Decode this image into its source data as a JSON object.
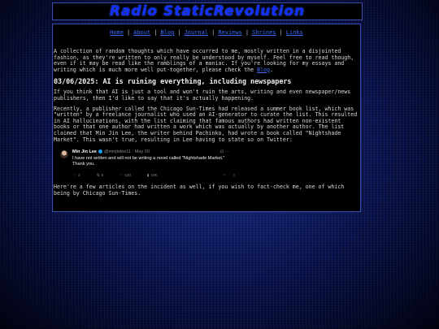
{
  "site": {
    "title": "Radio StaticRevolution"
  },
  "nav": [
    {
      "label": "Home"
    },
    {
      "label": "About"
    },
    {
      "label": "Blog"
    },
    {
      "label": "Journal"
    },
    {
      "label": "Reviews"
    },
    {
      "label": "Shrines"
    },
    {
      "label": "Links"
    }
  ],
  "intro": {
    "text": "A collection of random thoughts which have occurred to me, mostly written in a disjointed fashion, as they're written to only really be understood by myself. Feel free to read though, even if it may be read like the ramblings of a maniac. If you're looking for my essays and writing which is much more well put-together, please check the ",
    "link": "Blog",
    "end": "."
  },
  "entry": {
    "heading": "03/06/2025: AI is ruining everything, including newspapers",
    "p1": "If you think that AI is just a tool and won't ruin the arts, writing and even newspaper/news publishers, then I'd like to say that it's actually happening.",
    "p2": "Recently, a publisher called the Chicago Sun-Times had released a summer book list, which was \"written\" by a freelance journalist who used an AI-generator to curate the list. This resulted in AI hallucinations, with the list claiming that famous authors had written non-existent books or that one author had written a work which was actually by another author. The list claimed that Min Jin Lee, the writer behind Pachinko, had wrote a book called \"Nightshade Market\". This wasn't true, resulting in Lee having to state so on Twitter:",
    "p3": "Here're a few articles on the incident as well, if you wish to fact-check me, one of which being by Chicago Sun-Times."
  },
  "tweet": {
    "name": "Min Jin Lee",
    "handle": "@minjinlee11 · May 20",
    "text": "I have not written and will not be writing a novel called \"Nightshade Market.\" Thank you.",
    "replies": "2",
    "reposts": "8",
    "likes": "120",
    "views": "10K"
  }
}
